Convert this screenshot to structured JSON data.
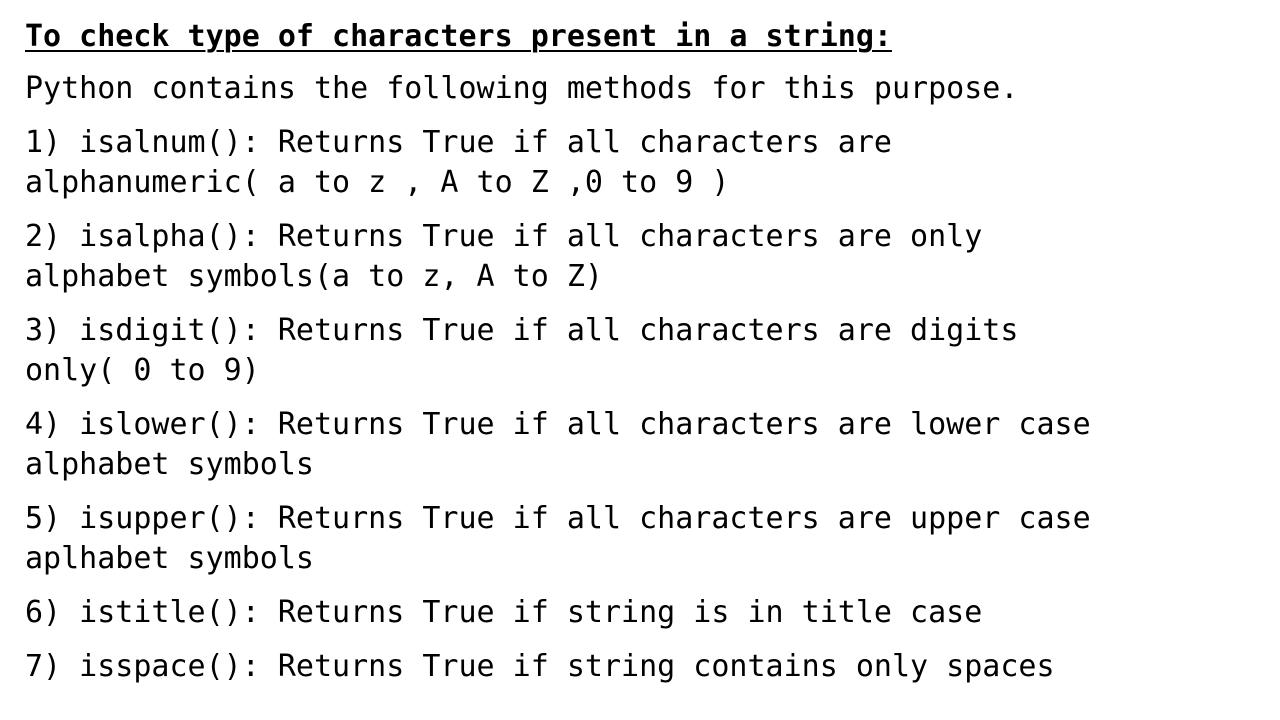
{
  "slide": {
    "title": "To check type of characters present in a string:",
    "intro": "Python contains the following methods for this purpose.",
    "methods": [
      {
        "line1": "1) isalnum(): Returns True if all characters are",
        "line2": "alphanumeric( a to z , A to Z ,0 to 9 )"
      },
      {
        "line1": "2) isalpha(): Returns True if all characters are only",
        "line2": "alphabet symbols(a to z, A to Z)"
      },
      {
        "line1": "3) isdigit(): Returns True if all characters are digits",
        "line2": "only( 0 to 9)"
      },
      {
        "line1": "4) islower(): Returns True if all characters are lower case",
        "line2": "alphabet symbols"
      },
      {
        "line1": "5) isupper(): Returns True if all characters are upper case",
        "line2": "aplhabet symbols"
      },
      {
        "line1": "6) istitle(): Returns True if string is in title case"
      },
      {
        "line1": "7) isspace(): Returns True if string contains only spaces"
      }
    ]
  }
}
